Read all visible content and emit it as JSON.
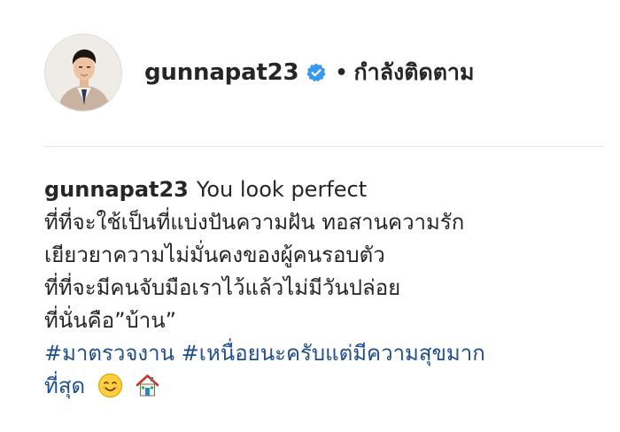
{
  "header": {
    "username": "gunnapat23",
    "separator": "•",
    "follow_status": "กำลังติดตาม",
    "verified_icon": "verified-badge-icon",
    "verified_color": "#3897f0"
  },
  "caption": {
    "username": "gunnapat23",
    "first_line_text": "You look perfect",
    "lines": [
      "ที่ที่จะใช้เป็นที่แบ่งปันความฝัน ทอสานความรัก",
      "เยียวยาความไม่มั่นคงของผู้คนรอบตัว",
      "ที่ที่จะมีคนจับมือเราไว้แล้วไม่มีวันปล่อย",
      "ที่นั่นคือ”บ้าน”"
    ],
    "hashtag_1": "#มาตรวจงาน",
    "hashtag_2_part1": "#เหนื่อยนะครับแต่มีความสุขมาก",
    "hashtag_2_part2": "ที่สุด",
    "emojis": [
      "smiling-face-icon",
      "house-icon"
    ],
    "hashtag_color": "#1f4e8c"
  }
}
